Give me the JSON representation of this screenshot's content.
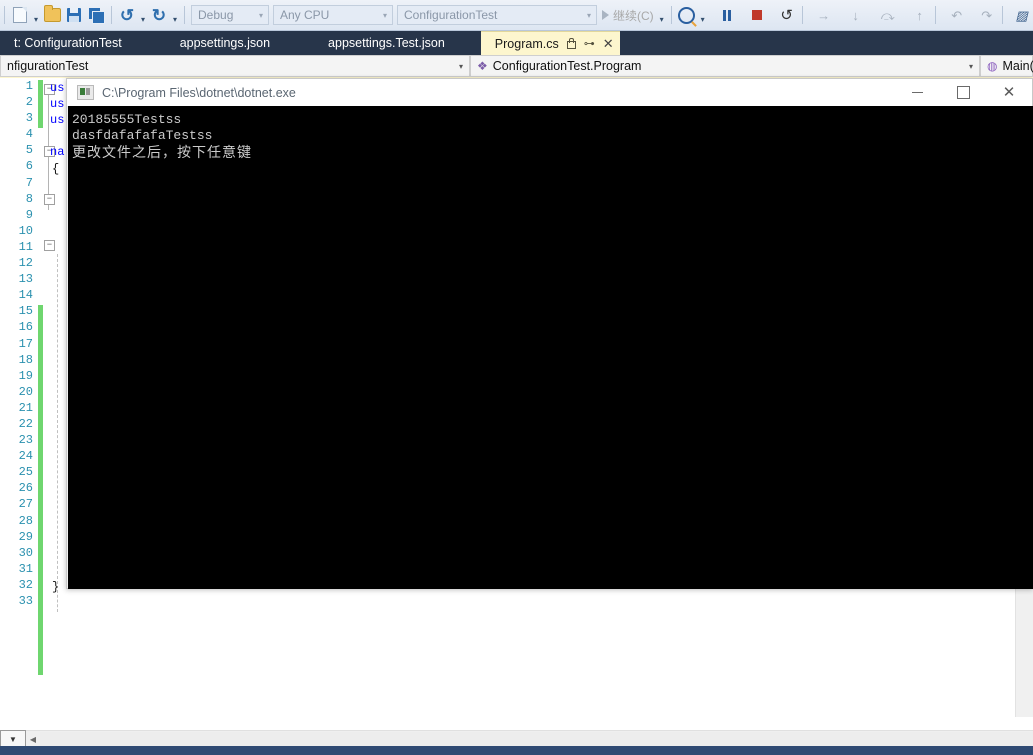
{
  "toolbar": {
    "icons": [
      {
        "name": "new-item-icon",
        "glyph": "new-file"
      },
      {
        "name": "open-file-icon",
        "glyph": "folder"
      },
      {
        "name": "save-icon",
        "glyph": "save"
      },
      {
        "name": "save-all-icon",
        "glyph": "save-all"
      },
      {
        "name": "undo-icon",
        "glyph": "undo"
      },
      {
        "name": "redo-icon",
        "glyph": "redo"
      }
    ],
    "config_combo": "Debug",
    "platform_combo": "Any CPU",
    "project_combo": "ConfigurationTest",
    "continue_label": "继续(C)",
    "debug_icons": [
      {
        "name": "attach-process-icon"
      },
      {
        "name": "break-all-icon"
      },
      {
        "name": "stop-debugging-icon"
      },
      {
        "name": "restart-icon"
      },
      {
        "name": "step-over-icon"
      },
      {
        "name": "step-into-icon"
      },
      {
        "name": "step-out-icon"
      },
      {
        "name": "show-next-statement-icon"
      },
      {
        "name": "navigate-backward-icon"
      },
      {
        "name": "navigate-forward-icon"
      },
      {
        "name": "diagnostic-tools-icon"
      },
      {
        "name": "window-layout-icon"
      }
    ]
  },
  "tabs": [
    {
      "label": "t: ConfigurationTest",
      "active": false
    },
    {
      "label": "appsettings.json",
      "active": false
    },
    {
      "label": "appsettings.Test.json",
      "active": false
    },
    {
      "label": "Program.cs",
      "active": true
    }
  ],
  "navbar": {
    "project": "nfigurationTest",
    "type": "ConfigurationTest.Program",
    "member": "Main("
  },
  "editor": {
    "first_line": 1,
    "last_line": 33,
    "code_lines": [
      {
        "line": 1,
        "text": "us"
      },
      {
        "line": 2,
        "text": "us"
      },
      {
        "line": 3,
        "text": "us"
      },
      {
        "line": 5,
        "text": "na"
      },
      {
        "line": 6,
        "text": "{"
      },
      {
        "line": 31,
        "text": "}"
      },
      {
        "line": 32,
        "text": "}"
      }
    ]
  },
  "console": {
    "title": "C:\\Program Files\\dotnet\\dotnet.exe",
    "window_buttons": [
      "minimize",
      "maximize",
      "close"
    ],
    "output": [
      "20185555Testss",
      "dasfdafafafaTestss",
      "更改文件之后，按下任意键"
    ]
  },
  "colors": {
    "tabstrip_bg": "#27354a",
    "active_tab_bg": "#fdf6ce",
    "console_bg": "#000000",
    "console_fg": "#cccccc",
    "linenumber_fg": "#2b91af",
    "changebar_green": "#6fd66f",
    "statusbar_bg": "#2f4a73"
  }
}
